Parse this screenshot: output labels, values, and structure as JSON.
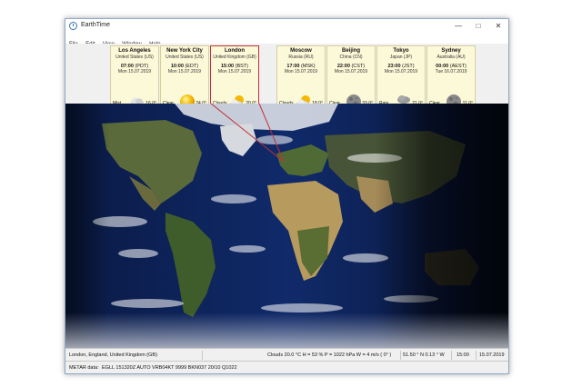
{
  "window": {
    "title": "EarthTime"
  },
  "menu": [
    "File",
    "Edit",
    "View",
    "Window",
    "Help"
  ],
  "cities": [
    {
      "name": "Los Angeles",
      "country": "United States (US)",
      "time": "07:00",
      "zone": "(PDT)",
      "date": "Mon 15.07.2019",
      "condition": "Mist",
      "temp": "16.0°",
      "icon": "mist-icon"
    },
    {
      "name": "New York City",
      "country": "United States (US)",
      "time": "10:00",
      "zone": "(EDT)",
      "date": "Mon 15.07.2019",
      "condition": "Clear",
      "temp": "24.0°",
      "icon": "sun-icon"
    },
    {
      "name": "London",
      "country": "United Kingdom (GB)",
      "time": "15:00",
      "zone": "(BST)",
      "date": "Mon 15.07.2019",
      "condition": "Clouds",
      "temp": "20.0°",
      "icon": "partly-cloudy-icon"
    },
    {
      "name": "Moscow",
      "country": "Russia (RU)",
      "time": "17:00",
      "zone": "(MSK)",
      "date": "Mon 15.07.2019",
      "condition": "Clouds",
      "temp": "18.0°",
      "icon": "partly-cloudy-icon"
    },
    {
      "name": "Beijing",
      "country": "China (CN)",
      "time": "22:00",
      "zone": "(CST)",
      "date": "Mon 15.07.2019",
      "condition": "Clear",
      "temp": "33.0°",
      "icon": "moon-icon"
    },
    {
      "name": "Tokyo",
      "country": "Japan (JP)",
      "time": "23:00",
      "zone": "(JST)",
      "date": "Mon 15.07.2019",
      "condition": "Rain",
      "temp": "21.0°",
      "icon": "rain-icon"
    },
    {
      "name": "Sydney",
      "country": "Australia (AU)",
      "time": "00:00",
      "zone": "(AEST)",
      "date": "Tue 16.07.2019",
      "condition": "Clear",
      "temp": "11.0°",
      "icon": "moon-icon"
    }
  ],
  "status": {
    "location": "London, England, United Kingdom (GB)",
    "weather": "Clouds  20.0 °C   H = 53 %   P = 1022 hPa   W = 4 m/s  ( 0° )",
    "coords": "51.50 ° N  0.13 ° W",
    "time": "15:00",
    "date": "15.07.2019"
  },
  "metar": {
    "label": "METAR data:",
    "value": "EGLL 151320Z AUTO VRB04KT 9999 BKN037 20/10 Q1022"
  },
  "colors": {
    "panel_bg": "#fcf9d8",
    "selected_border": "#c0303a",
    "ocean": "#0d1f52"
  }
}
